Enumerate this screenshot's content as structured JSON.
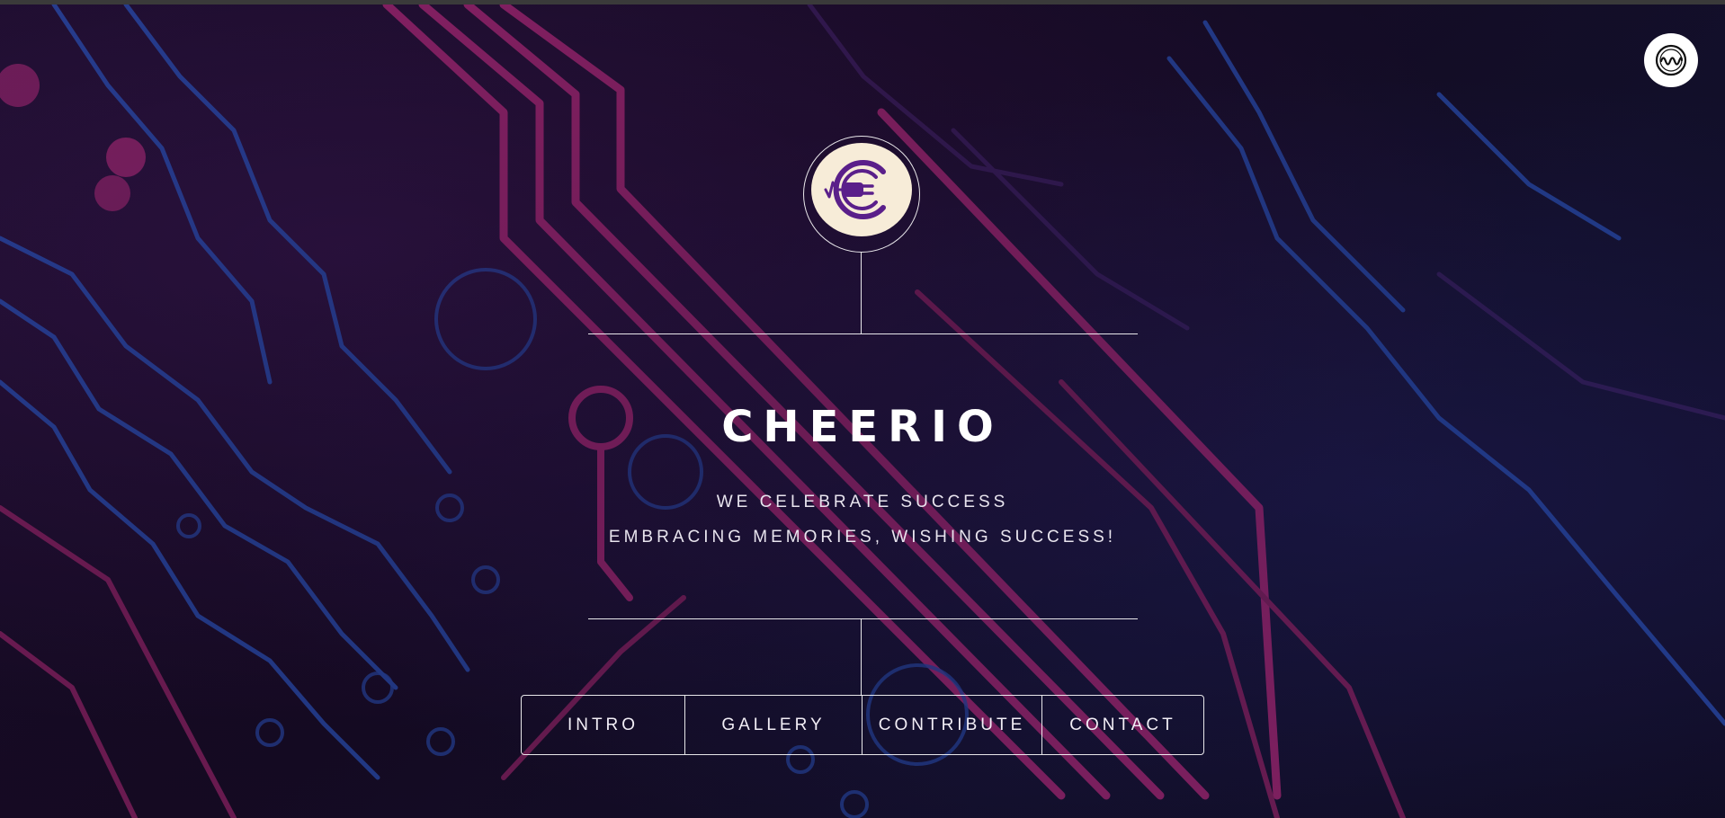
{
  "site": {
    "title": "CHEERIO",
    "tagline_line1": "WE CELEBRATE SUCCESS",
    "tagline_line2": "EMBRACING MEMORIES, WISHING SUCCESS!"
  },
  "logo": {
    "icon": "plug-euro-icon",
    "colors": {
      "disc": "#f7ecd8",
      "mark": "#5a1f8a"
    }
  },
  "corner_badge": {
    "icon": "wave-circle-icon"
  },
  "nav": {
    "items": [
      {
        "label": "INTRO"
      },
      {
        "label": "GALLERY"
      },
      {
        "label": "CONTRIBUTE"
      },
      {
        "label": "CONTACT"
      }
    ]
  },
  "theme": {
    "accent_pink": "#e0338f",
    "accent_blue": "#2f5fd6",
    "background": "#170b25",
    "line": "#ffffff"
  }
}
